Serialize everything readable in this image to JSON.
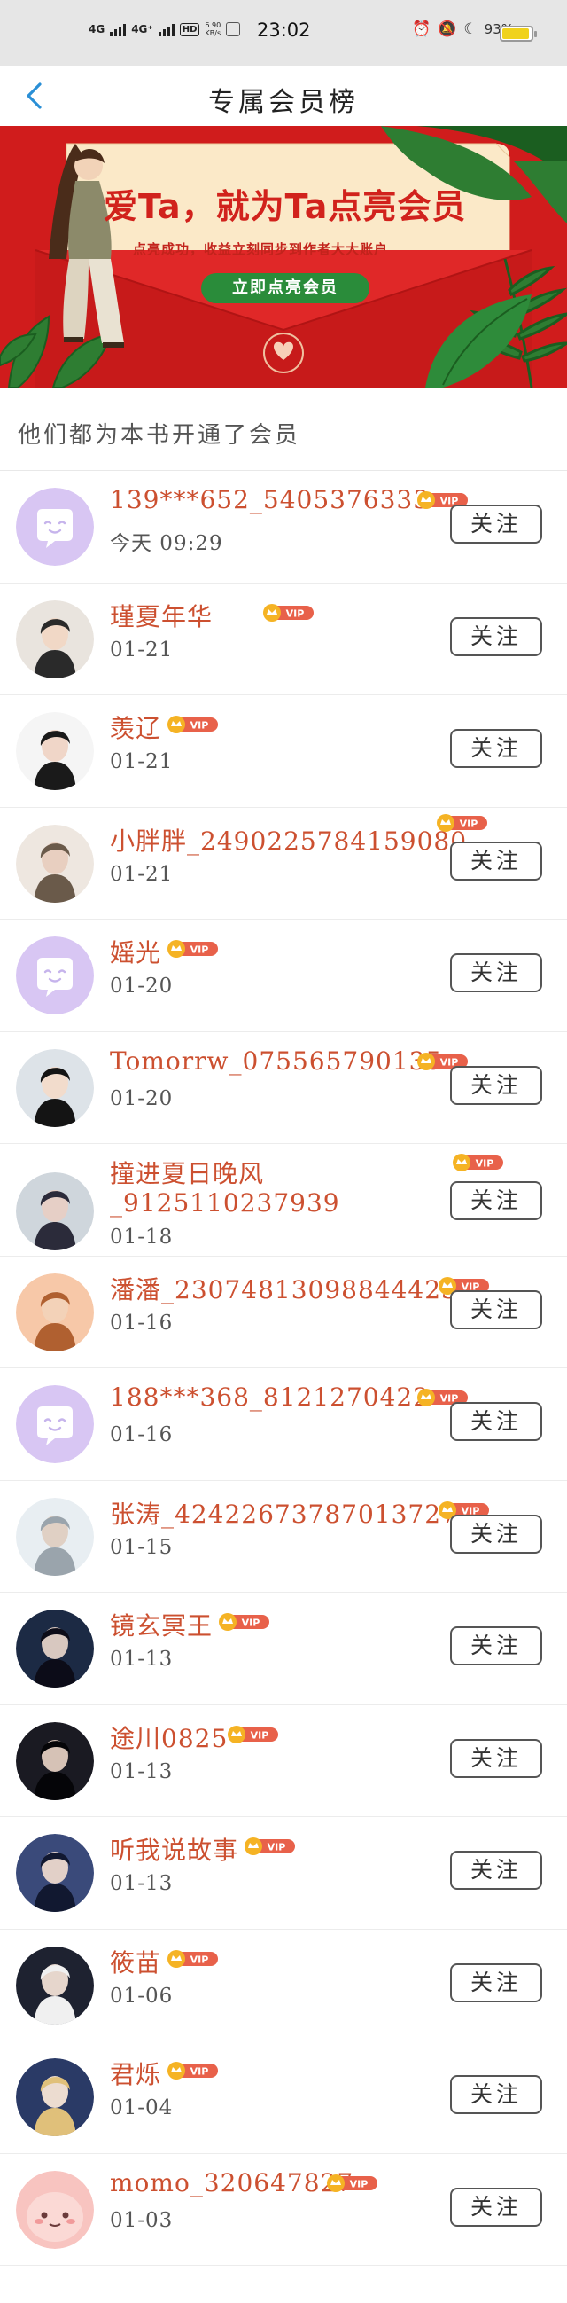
{
  "status_bar": {
    "network_left": "4G",
    "network_right": "4G⁺",
    "hd_label": "HD",
    "hd_sub": "1 2",
    "speed_value": "6.90",
    "speed_unit": "KB/s",
    "time": "23:02",
    "battery_text": "93%",
    "battery_level": 0.93,
    "icons": [
      "alarm-icon",
      "mute-icon",
      "moon-icon",
      "battery-icon"
    ]
  },
  "nav": {
    "title": "专属会员榜",
    "back_icon": "chevron-left-icon",
    "accent": "#2a8fd6"
  },
  "banner": {
    "title": "爱Ta，就为Ta点亮会员",
    "subtitle": "点亮成功，收益立刻同步到作者大大账户",
    "button": "立即点亮会员",
    "background": "#d01c1c"
  },
  "section": {
    "title": "他们都为本书开通了会员"
  },
  "vip_label": "VIP",
  "follow_label": "关注",
  "members": [
    {
      "name": "139***652_5405376333",
      "date": "今天 09:29",
      "avatar": "default"
    },
    {
      "name": "瑾夏年华",
      "date": "01-21",
      "avatar": "photo"
    },
    {
      "name": "羡辽",
      "date": "01-21",
      "avatar": "photo"
    },
    {
      "name": "小胖胖_2490225784159080",
      "date": "01-21",
      "avatar": "photo"
    },
    {
      "name": "媱光",
      "date": "01-20",
      "avatar": "default"
    },
    {
      "name": "Tomorrw_075565790135",
      "date": "01-20",
      "avatar": "photo"
    },
    {
      "name": "撞进夏日晚风",
      "name2": "_9125110237939",
      "date": "01-18",
      "avatar": "photo"
    },
    {
      "name": "潘潘_23074813098844423",
      "date": "01-16",
      "avatar": "photo"
    },
    {
      "name": "188***368_8121270422",
      "date": "01-16",
      "avatar": "default"
    },
    {
      "name": "张涛_42422673787013727",
      "date": "01-15",
      "avatar": "photo"
    },
    {
      "name": "镜玄冥王",
      "date": "01-13",
      "avatar": "photo"
    },
    {
      "name": "途川0825",
      "date": "01-13",
      "avatar": "photo"
    },
    {
      "name": "听我说故事",
      "date": "01-13",
      "avatar": "photo"
    },
    {
      "name": "筱苗",
      "date": "01-06",
      "avatar": "photo"
    },
    {
      "name": "君烁",
      "date": "01-04",
      "avatar": "photo"
    },
    {
      "name": "momo_320647827",
      "date": "01-03",
      "avatar": "pink"
    }
  ]
}
